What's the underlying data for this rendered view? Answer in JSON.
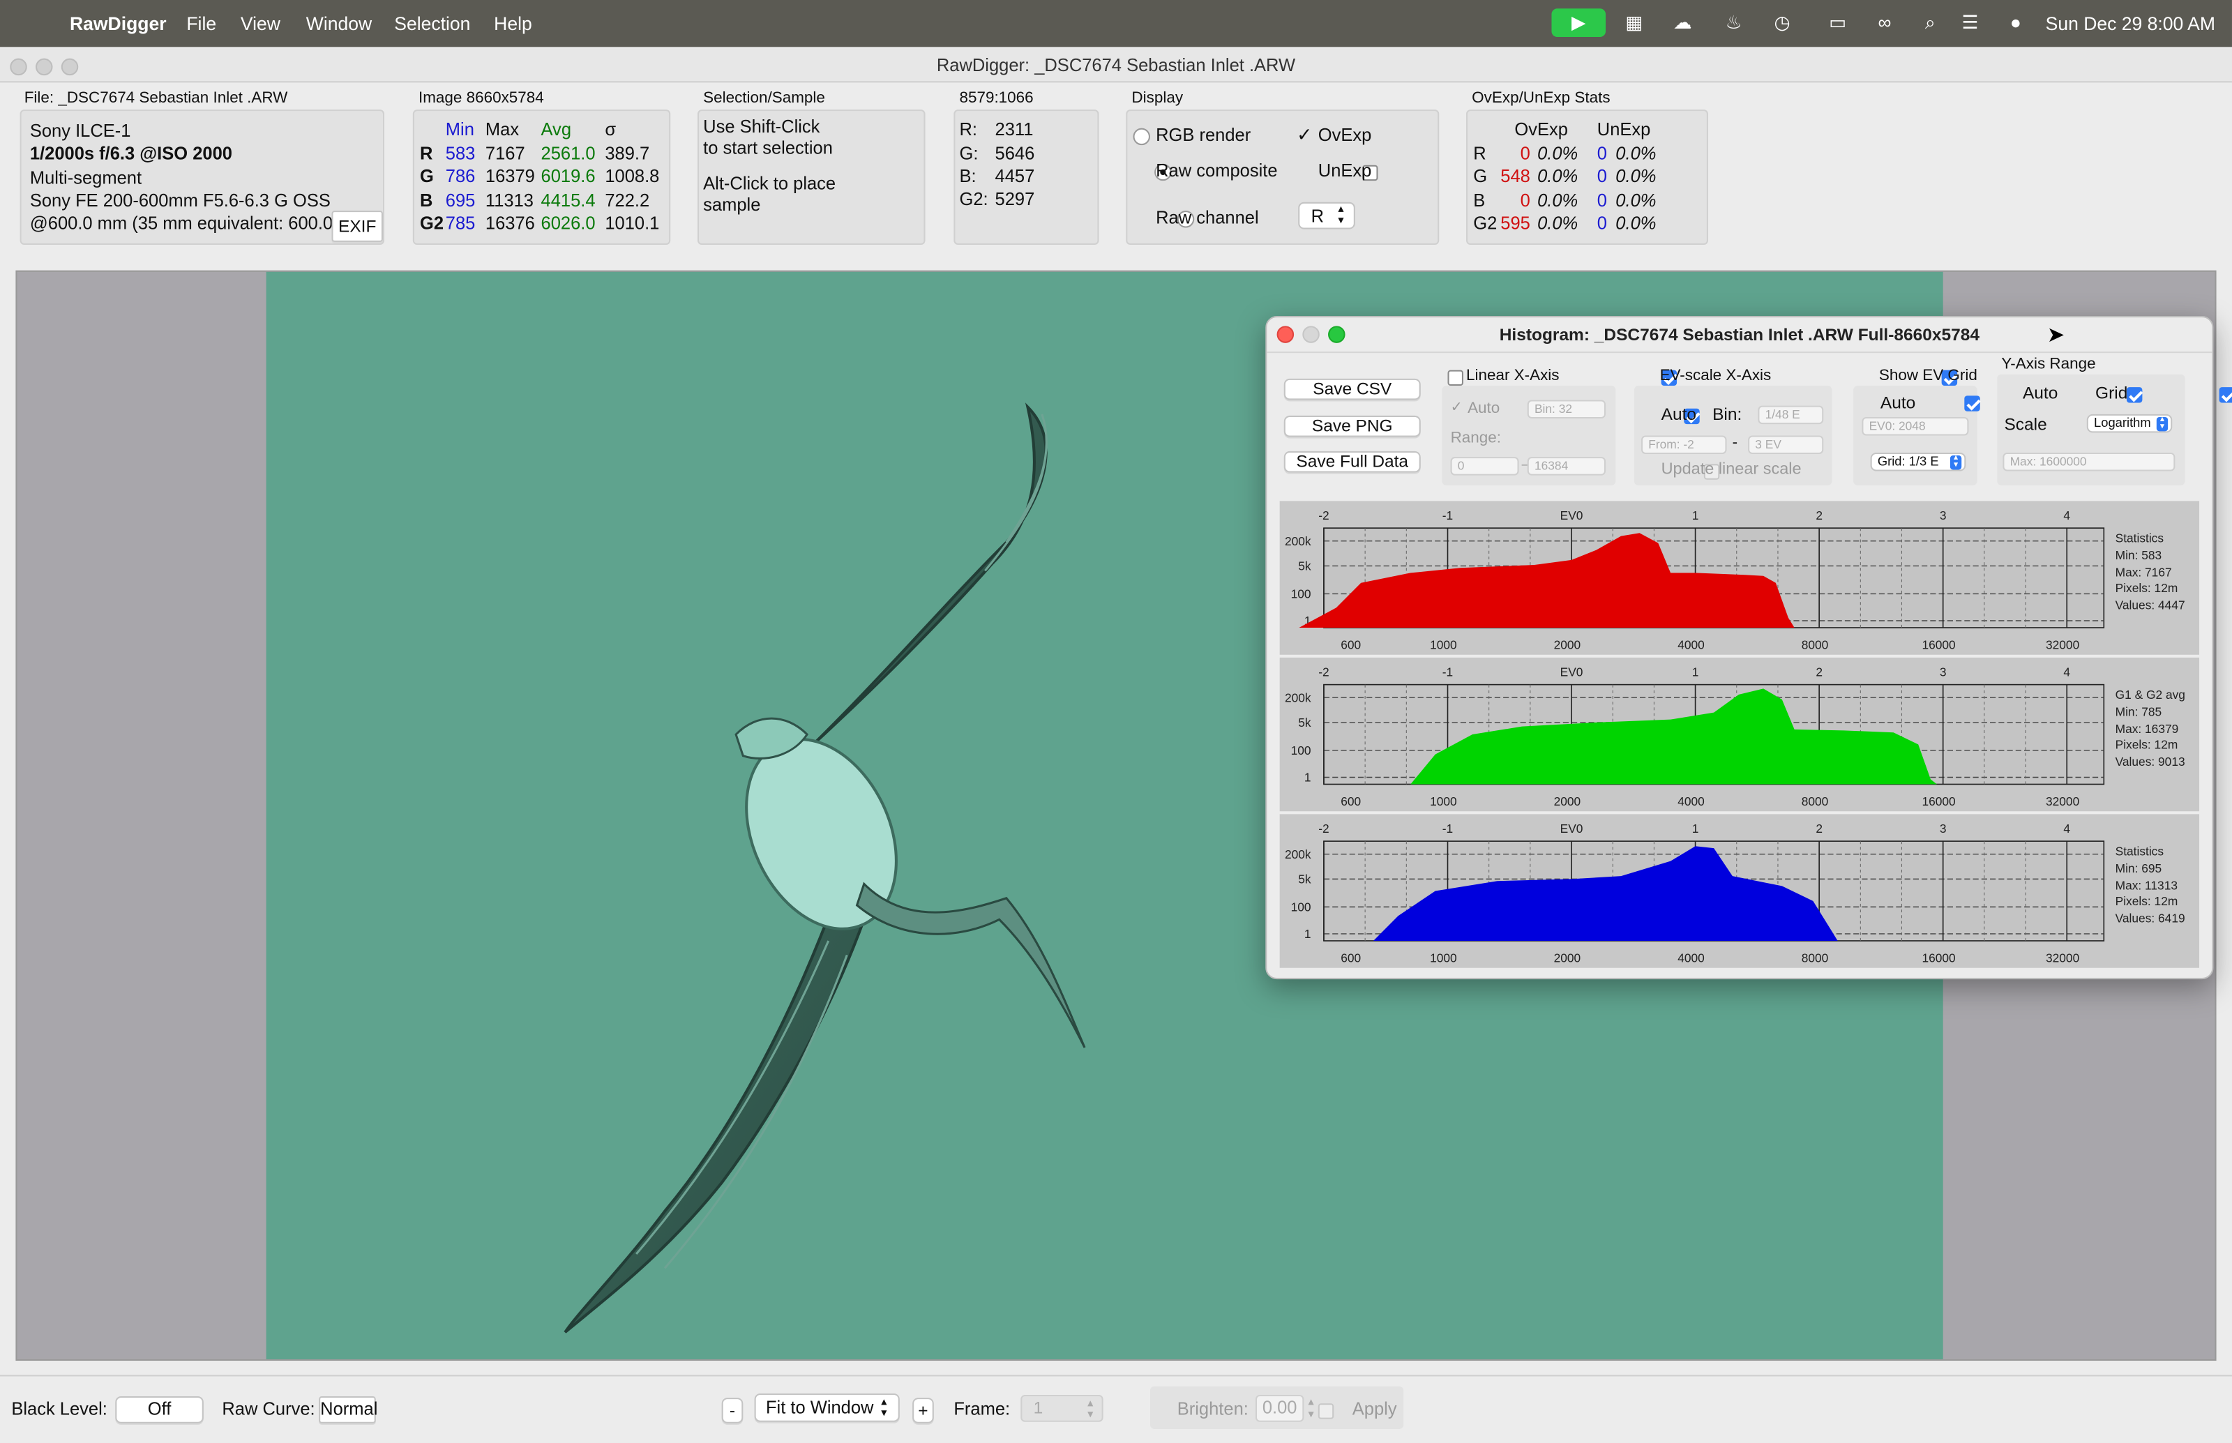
{
  "menubar": {
    "app_name": "RawDigger",
    "items": [
      "File",
      "View",
      "Window",
      "Selection",
      "Help"
    ],
    "clock": "Sun Dec 29  8:00 AM"
  },
  "window": {
    "title": "RawDigger: _DSC7674 Sebastian Inlet .ARW"
  },
  "file_panel": {
    "label": "File: _DSC7674 Sebastian Inlet .ARW",
    "camera": "Sony ILCE-1",
    "exposure": "1/2000s f/6.3 @ISO 2000",
    "mode": "Multi-segment",
    "lens": "Sony FE 200-600mm F5.6-6.3 G OSS",
    "focal": "@600.0 mm (35 mm equivalent: 600.0",
    "exif_button": "EXIF"
  },
  "image_panel": {
    "label": "Image 8660x5784",
    "headers": [
      "Min",
      "Max",
      "Avg",
      "σ"
    ],
    "rows": [
      {
        "ch": "R",
        "min": "583",
        "max": "7167",
        "avg": "2561.0",
        "sd": "389.7"
      },
      {
        "ch": "G",
        "min": "786",
        "max": "16379",
        "avg": "6019.6",
        "sd": "1008.8"
      },
      {
        "ch": "B",
        "min": "695",
        "max": "11313",
        "avg": "4415.4",
        "sd": "722.2"
      },
      {
        "ch": "G2",
        "min": "785",
        "max": "16376",
        "avg": "6026.0",
        "sd": "1010.1"
      }
    ]
  },
  "selection_panel": {
    "label": "Selection/Sample",
    "line1": "Use Shift-Click",
    "line2": "to start selection",
    "line3": "Alt-Click to place",
    "line4": "sample"
  },
  "coord_panel": {
    "label": "8579:1066",
    "rows": [
      {
        "ch": "R:",
        "val": "2311"
      },
      {
        "ch": "G:",
        "val": "5646"
      },
      {
        "ch": "B:",
        "val": "4457"
      },
      {
        "ch": "G2:",
        "val": "5297"
      }
    ]
  },
  "display_panel": {
    "label": "Display",
    "rgb_render": "RGB render",
    "raw_composite": "Raw composite",
    "raw_channel": "Raw channel",
    "ovexp": "OvExp",
    "unexp": "UnExp",
    "channel_value": "R"
  },
  "ovexp_panel": {
    "label": "OvExp/UnExp Stats",
    "headers": [
      "OvExp",
      "UnExp"
    ],
    "rows": [
      {
        "ch": "R",
        "ov": "0",
        "ovp": "0.0%",
        "un": "0",
        "unp": "0.0%"
      },
      {
        "ch": "G",
        "ov": "548",
        "ovp": "0.0%",
        "un": "0",
        "unp": "0.0%"
      },
      {
        "ch": "B",
        "ov": "0",
        "ovp": "0.0%",
        "un": "0",
        "unp": "0.0%"
      },
      {
        "ch": "G2",
        "ov": "595",
        "ovp": "0.0%",
        "un": "0",
        "unp": "0.0%"
      }
    ]
  },
  "histogram": {
    "title": "Histogram: _DSC7674 Sebastian Inlet .ARW Full-8660x5784",
    "buttons": {
      "save_csv": "Save CSV",
      "save_png": "Save PNG",
      "save_full": "Save Full Data"
    },
    "linear": {
      "label": "Linear X-Axis",
      "auto": "Auto",
      "bin": "Bin: 32",
      "range": "Range:",
      "from": "0",
      "to": "16384"
    },
    "ev": {
      "label": "EV-scale X-Axis",
      "auto": "Auto",
      "bin_label": "Bin:",
      "bin": "1/48 E",
      "from": "From: -2",
      "to": "3 EV",
      "dash": "-",
      "update": "Update linear scale"
    },
    "grid": {
      "label": "Show EV Grid",
      "auto": "Auto",
      "ev0": "EV0: 2048",
      "grid": "Grid: 1/3 E"
    },
    "yaxis": {
      "label": "Y-Axis Range",
      "auto": "Auto",
      "grid": "Grid",
      "scale_label": "Scale",
      "scale": "Logarithm",
      "max": "Max: 1600000"
    },
    "ev_ticks": [
      "-2",
      "-1",
      "EV0",
      "1",
      "2",
      "3",
      "4"
    ],
    "x_ticks": [
      "600",
      "1000",
      "2000",
      "4000",
      "8000",
      "16000",
      "32000"
    ],
    "y_ticks": [
      "200k",
      "5k",
      "100",
      "1"
    ],
    "panels": [
      {
        "channel": "red",
        "color": "#e00000",
        "stats": [
          "Statistics",
          "Min: 583",
          "Max: 7167",
          "Pixels: 12m",
          "Values: 4447"
        ]
      },
      {
        "channel": "green",
        "color": "#00d400",
        "stats": [
          "G1 & G2 avg",
          "Min: 785",
          "Max: 16379",
          "Pixels: 12m",
          "Values: 9013"
        ]
      },
      {
        "channel": "blue",
        "color": "#0000dd",
        "stats": [
          "Statistics",
          "Min: 695",
          "Max: 11313",
          "Pixels: 12m",
          "Values: 6419"
        ]
      }
    ]
  },
  "bottombar": {
    "black_level_label": "Black Level:",
    "black_level": "Off",
    "raw_curve_label": "Raw Curve:",
    "raw_curve": "Normal",
    "minus": "-",
    "zoom": "Fit to Window",
    "plus": "+",
    "frame_label": "Frame:",
    "frame": "1",
    "brighten_label": "Brighten:",
    "brighten": "0.00",
    "apply": "Apply"
  }
}
